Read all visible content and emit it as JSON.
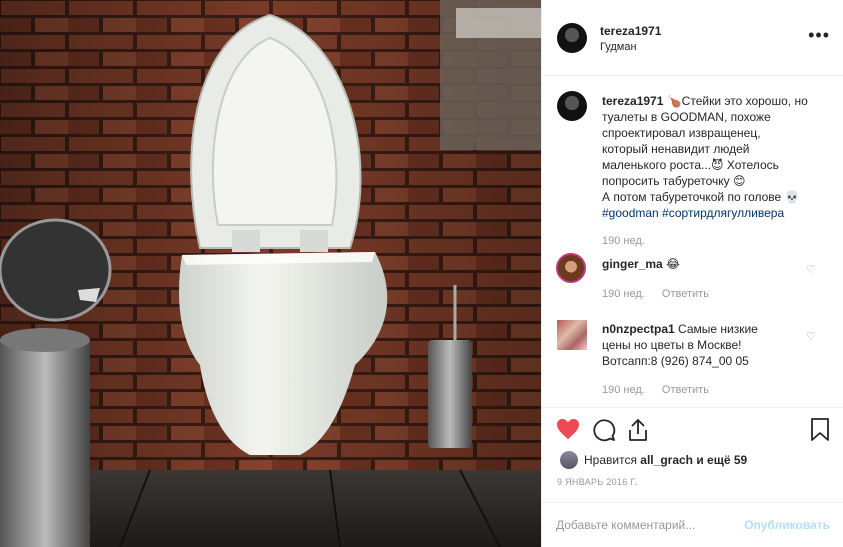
{
  "header": {
    "username": "tereza1971",
    "location": "Гудман",
    "more_label": "•••"
  },
  "caption": {
    "username": "tereza1971",
    "lines": [
      "🍗Стейки это хорошо, но",
      "туалеты в GOODMAN, похоже",
      "спроектировал извращенец,",
      "который ненавидит людей",
      "маленького роста...😈 Хотелось",
      "попросить табуреточку 😊",
      "А потом табуреточкой по голове 💀"
    ],
    "hashtags": "#goodman #сортирдлягулливера",
    "time": "190 нед."
  },
  "comments": [
    {
      "username": "ginger_ma",
      "text": "😂",
      "time": "190 нед.",
      "reply": "Ответить"
    },
    {
      "username": "n0nzpectpa1",
      "lines": [
        "Самые низкие",
        "цены но цветы в Москве!",
        "Вотсапп:8 (926) 874_00 05"
      ],
      "time": "190 нед.",
      "reply": "Ответить"
    }
  ],
  "likes": {
    "prefix": "Нравится",
    "user": "all_grach",
    "suffix": "и ещё 59"
  },
  "date": "9 ЯНВАРЬ 2016 Г.",
  "add_comment": {
    "placeholder": "Добавьте комментарий...",
    "post_label": "Опубликовать"
  },
  "colors": {
    "like_red": "#ed4956",
    "hashtag_blue": "#003569",
    "muted": "#999999",
    "post_disabled": "#b2dffc"
  },
  "icons": [
    "heart-icon",
    "comment-icon",
    "share-icon",
    "bookmark-icon",
    "small-heart-icon",
    "more-icon"
  ]
}
